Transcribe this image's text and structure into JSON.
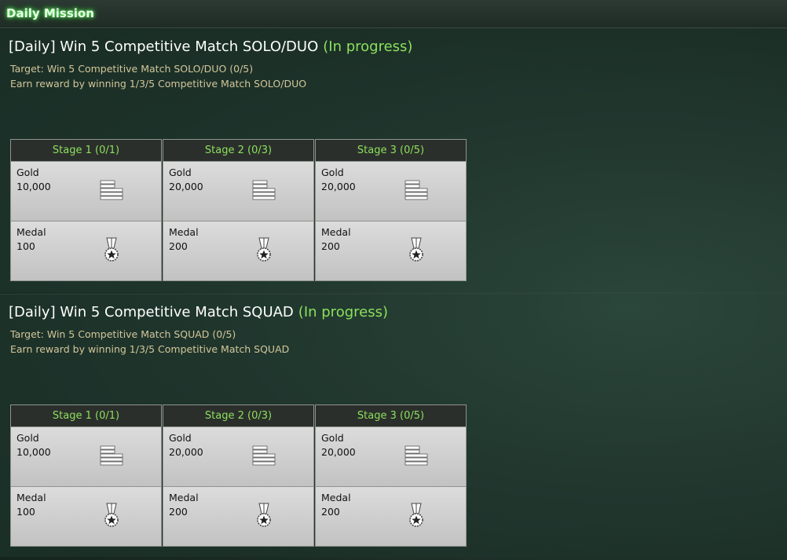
{
  "header": {
    "title": "Daily Mission"
  },
  "missions": [
    {
      "title": "[Daily] Win 5 Competitive Match SOLO/DUO",
      "status": "(In progress)",
      "target": "Target: Win 5 Competitive Match SOLO/DUO (0/5)",
      "description": "Earn reward by winning 1/3/5 Competitive Match SOLO/DUO",
      "stages": [
        {
          "label": "Stage 1 (0/1)",
          "gold_label": "Gold",
          "gold": "10,000",
          "medal_label": "Medal",
          "medal": "100"
        },
        {
          "label": "Stage 2 (0/3)",
          "gold_label": "Gold",
          "gold": "20,000",
          "medal_label": "Medal",
          "medal": "200"
        },
        {
          "label": "Stage 3 (0/5)",
          "gold_label": "Gold",
          "gold": "20,000",
          "medal_label": "Medal",
          "medal": "200"
        }
      ]
    },
    {
      "title": "[Daily] Win 5 Competitive Match SQUAD",
      "status": "(In progress)",
      "target": "Target: Win 5 Competitive Match SQUAD (0/5)",
      "description": "Earn reward by winning 1/3/5 Competitive Match SQUAD",
      "stages": [
        {
          "label": "Stage 1 (0/1)",
          "gold_label": "Gold",
          "gold": "10,000",
          "medal_label": "Medal",
          "medal": "100"
        },
        {
          "label": "Stage 2 (0/3)",
          "gold_label": "Gold",
          "gold": "20,000",
          "medal_label": "Medal",
          "medal": "200"
        },
        {
          "label": "Stage 3 (0/5)",
          "gold_label": "Gold",
          "gold": "20,000",
          "medal_label": "Medal",
          "medal": "200"
        }
      ]
    }
  ],
  "icons": {
    "gold": "gold-bars-icon",
    "medal": "medal-icon"
  },
  "colors": {
    "status_green": "#8ce05c",
    "target_tan": "#d3c69a",
    "stage_header": "#2b2f2c"
  }
}
